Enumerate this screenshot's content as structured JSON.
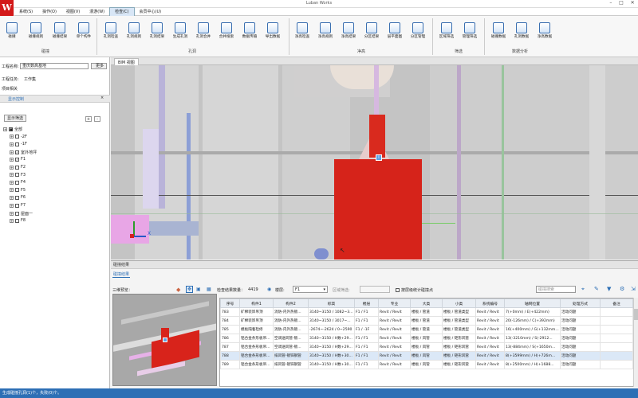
{
  "app": {
    "title": "Luban Works"
  },
  "menu": [
    "系统(S)",
    "操作(O)",
    "视图(V)",
    "漫游(W)",
    "检查(C)",
    "会员中心(U)"
  ],
  "ribbon": {
    "buttons": [
      "碰撞",
      "碰撞规则",
      "碰撞结果",
      "单个构件",
      "孔洞检查",
      "孔洞规则",
      "孔洞结果",
      "生成孔洞",
      "孔洞合并",
      "合并搜索",
      "数据传输",
      "导出数据",
      "净高检查",
      "净高规则",
      "净高结果",
      "分区结果",
      "层平面图",
      "分区管理",
      "区域筛选",
      "管理筛选",
      "碰撞数据",
      "孔洞数据",
      "净高数据"
    ],
    "groups": [
      "碰撞",
      "孔洞",
      "净高",
      "筛选",
      "数据分析"
    ]
  },
  "left": {
    "project_label": "工程名称:",
    "project_value": "重庆数高基地",
    "more_btn": "更多",
    "task_label": "工程任务:",
    "task_value": "工作集",
    "proj_related": "项目相关",
    "panel_tab": "显示控制",
    "filter_btn": "显示筛选",
    "tree": [
      {
        "label": "全部",
        "checked": "■",
        "level": 0
      },
      {
        "label": "-2F",
        "checked": "",
        "level": 1
      },
      {
        "label": "-1F",
        "checked": "",
        "level": 1
      },
      {
        "label": "室外地坪",
        "checked": "✓",
        "level": 1
      },
      {
        "label": "F1",
        "checked": "✓",
        "level": 1
      },
      {
        "label": "F2",
        "checked": "",
        "level": 1
      },
      {
        "label": "F3",
        "checked": "",
        "level": 1
      },
      {
        "label": "F4",
        "checked": "",
        "level": 1
      },
      {
        "label": "F5",
        "checked": "",
        "level": 1
      },
      {
        "label": "F6",
        "checked": "",
        "level": 1
      },
      {
        "label": "F7",
        "checked": "",
        "level": 1
      },
      {
        "label": "屋面一",
        "checked": "",
        "level": 1
      },
      {
        "label": "F8",
        "checked": "",
        "level": 1
      }
    ]
  },
  "viewport": {
    "tab": "BIM 视图",
    "axis_x": "X"
  },
  "bottom": {
    "tab_bar": "碰撞结果",
    "tab": "碰撞结果",
    "preview_label": "三维预览：",
    "count_label": "检查结果数量：",
    "count_value": "4419",
    "floor_label": "楼层:",
    "floor_value": "F1",
    "region_label": "区域筛选:",
    "checkbox_label": "按层级统计碰撞点",
    "search_placeholder": "碰撞搜索",
    "columns": [
      "序号",
      "构件1",
      "构件2",
      "标高",
      "楼层",
      "专业",
      "大类",
      "小类",
      "系统编号",
      "轴网位置",
      "处理方式",
      "备注"
    ],
    "rows": [
      [
        "783",
        "矿棉装饰吊顶",
        "消防-内外热镀...",
        "3140~3150 / 1082~3...",
        "F1 / F1",
        "Revit / Revit",
        "楼板 / 管道",
        "楼板 / 管道类型",
        "Revit / Revit",
        "7(+0mm) / E(+422mm)",
        "活动问题",
        ""
      ],
      [
        "784",
        "矿棉装饰吊顶",
        "消防-内外热镀...",
        "3140~3150 / 3017~...",
        "F1 / F1",
        "Revit / Revit",
        "楼板 / 管道",
        "楼板 / 管道类型",
        "Revit / Revit",
        "20(-126mm) / C(+392mm)",
        "活动问题",
        ""
      ],
      [
        "785",
        "模板隔着检修",
        "消防-内外热镀...",
        "-2674~-2624 / 0~2590",
        "F1 / -1F",
        "Revit / Revit",
        "楼板 / 管道",
        "楼板 / 管道类型",
        "Revit / Revit",
        "16(+400mm) / G(+132mm...",
        "活动问题",
        ""
      ],
      [
        "786",
        "铝合金条形板吊...",
        "空调送风管-镀...",
        "3140~3150 / H数+29...",
        "F1 / F1",
        "Revit / Revit",
        "楼板 / 风管",
        "楼板 / 矩形风管",
        "Revit / Revit",
        "13(-3210mm) / S(-2912...",
        "活动问题",
        ""
      ],
      [
        "787",
        "铝合金条形板吊...",
        "空调送风管-镀...",
        "3140~3150 / H数+29...",
        "F1 / F1",
        "Revit / Revit",
        "楼板 / 风管",
        "楼板 / 矩形风管",
        "Revit / Revit",
        "13(-884mm) / S(+1650m...",
        "活动问题",
        ""
      ],
      [
        "788",
        "铝合金条形板吊...",
        "排风管-镀锌钢管",
        "3140~3150 / H数+30...",
        "F1 / F1",
        "Revit / Revit",
        "楼板 / 风管",
        "楼板 / 矩形风管",
        "Revit / Revit",
        "8(+3599mm) / H(+726m...",
        "活动问题",
        ""
      ],
      [
        "789",
        "铝合金条形板吊...",
        "排风管-镀锌钢管",
        "3140~3150 / H数+30...",
        "F1 / F1",
        "Revit / Revit",
        "楼板 / 风管",
        "楼板 / 矩形风管",
        "Revit / Revit",
        "8(+2500mm) / H(+1688...",
        "活动问题",
        ""
      ]
    ]
  },
  "status": {
    "text": "生成碰撞孔洞(1)个，失败(0)个。"
  }
}
